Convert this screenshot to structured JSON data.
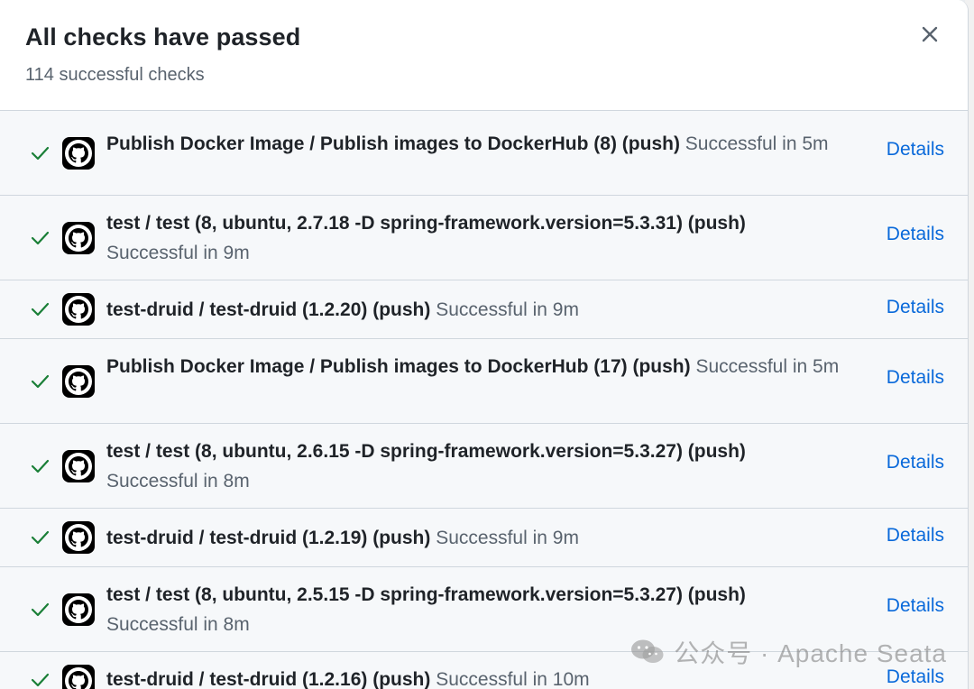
{
  "header": {
    "title": "All checks have passed",
    "subtitle": "114 successful checks"
  },
  "checks": [
    {
      "name": "Publish Docker Image / Publish images to DockerHub (8) (push)",
      "status": "Successful in 5m",
      "details_label": "Details"
    },
    {
      "name": "test / test (8, ubuntu, 2.7.18 -D spring-framework.version=5.3.31) (push)",
      "status": "Successful in 9m",
      "details_label": "Details"
    },
    {
      "name": "test-druid / test-druid (1.2.20) (push)",
      "status": "Successful in 9m",
      "details_label": "Details"
    },
    {
      "name": "Publish Docker Image / Publish images to DockerHub (17) (push)",
      "status": "Successful in 5m",
      "details_label": "Details"
    },
    {
      "name": "test / test (8, ubuntu, 2.6.15 -D spring-framework.version=5.3.27) (push)",
      "status": "Successful in 8m",
      "details_label": "Details"
    },
    {
      "name": "test-druid / test-druid (1.2.19) (push)",
      "status": "Successful in 9m",
      "details_label": "Details"
    },
    {
      "name": "test / test (8, ubuntu, 2.5.15 -D spring-framework.version=5.3.27) (push)",
      "status": "Successful in 8m",
      "details_label": "Details"
    },
    {
      "name": "test-druid / test-druid (1.2.16) (push)",
      "status": "Successful in 10m",
      "details_label": "Details"
    }
  ],
  "watermark": {
    "text": "公众号 · Apache Seata"
  },
  "icons": {
    "close": "close-icon",
    "check": "check-icon",
    "avatar": "github-logo-icon"
  },
  "colors": {
    "success": "#1a7f37",
    "link": "#0969da"
  }
}
